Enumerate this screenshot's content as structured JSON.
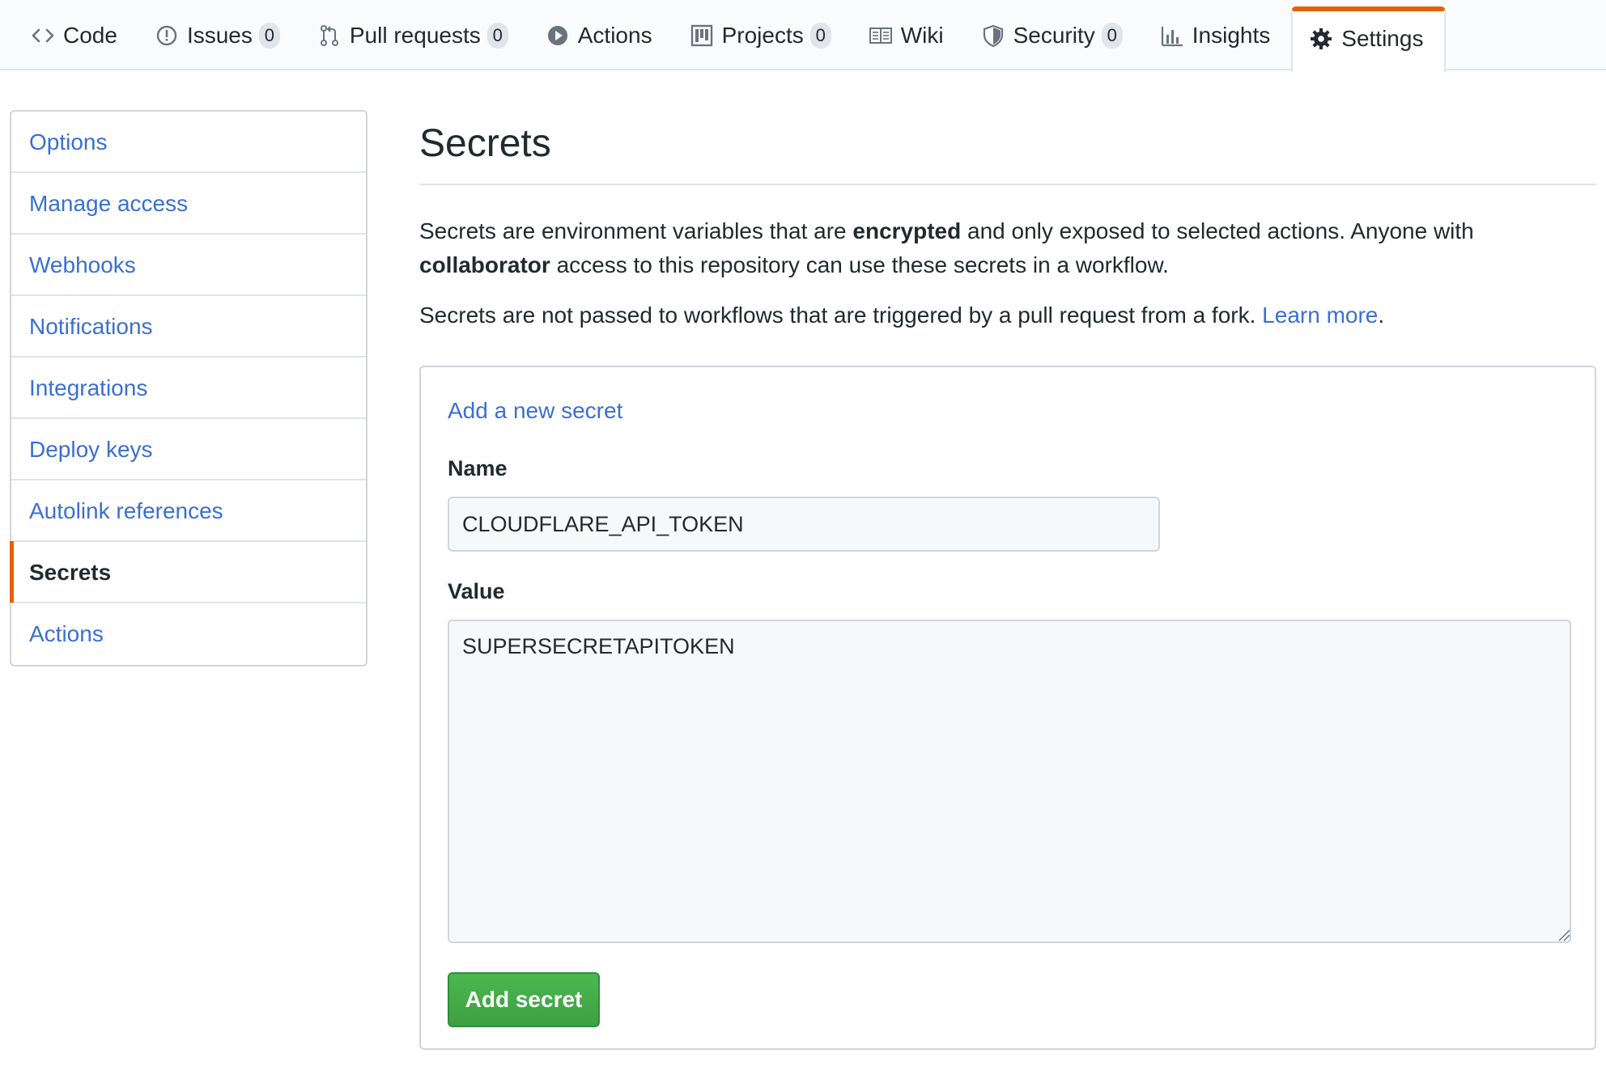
{
  "tabs": [
    {
      "label": "Code",
      "icon": "code-icon",
      "count": null
    },
    {
      "label": "Issues",
      "icon": "issue-icon",
      "count": "0"
    },
    {
      "label": "Pull requests",
      "icon": "pull-request-icon",
      "count": "0"
    },
    {
      "label": "Actions",
      "icon": "play-icon",
      "count": null
    },
    {
      "label": "Projects",
      "icon": "project-icon",
      "count": "0"
    },
    {
      "label": "Wiki",
      "icon": "book-icon",
      "count": null
    },
    {
      "label": "Security",
      "icon": "shield-icon",
      "count": "0"
    },
    {
      "label": "Insights",
      "icon": "graph-icon",
      "count": null
    },
    {
      "label": "Settings",
      "icon": "gear-icon",
      "count": null,
      "selected": true
    }
  ],
  "sidebar": {
    "items": [
      {
        "label": "Options"
      },
      {
        "label": "Manage access"
      },
      {
        "label": "Webhooks"
      },
      {
        "label": "Notifications"
      },
      {
        "label": "Integrations"
      },
      {
        "label": "Deploy keys"
      },
      {
        "label": "Autolink references"
      },
      {
        "label": "Secrets",
        "active": true
      },
      {
        "label": "Actions"
      }
    ]
  },
  "main": {
    "title": "Secrets",
    "desc": {
      "p1_a": "Secrets are environment variables that are ",
      "p1_b": "encrypted",
      "p1_c": " and only exposed to selected actions. Anyone with ",
      "p1_d": "collaborator",
      "p1_e": " access to this repository can use these secrets in a workflow.",
      "p2_a": "Secrets are not passed to workflows that are triggered by a pull request from a fork. ",
      "p2_link": "Learn more",
      "p2_end": "."
    },
    "form": {
      "heading_link": "Add a new secret",
      "name_label": "Name",
      "name_value": "CLOUDFLARE_API_TOKEN",
      "value_label": "Value",
      "value_value": "SUPERSECRETAPITOKEN",
      "submit_label": "Add secret"
    }
  },
  "colors": {
    "accent_orange": "#e36209",
    "link_blue": "#3b6fd1",
    "button_green": "#3ea043"
  }
}
